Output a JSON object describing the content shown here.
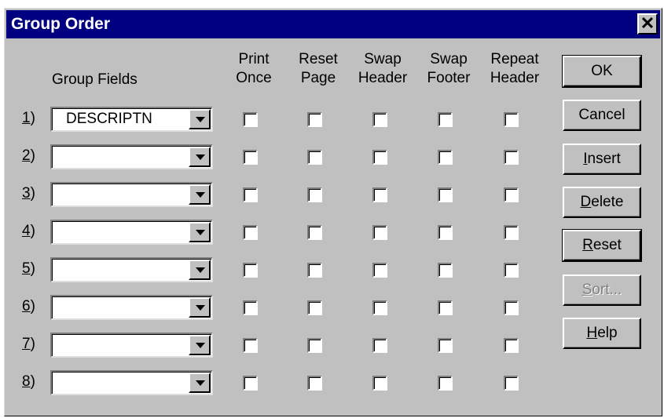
{
  "window": {
    "title": "Group Order",
    "close_glyph": "✕"
  },
  "group_fields_label": "Group Fields",
  "columns": [
    {
      "line1": "Print",
      "line2": "Once"
    },
    {
      "line1": "Reset",
      "line2": "Page"
    },
    {
      "line1": "Swap",
      "line2": "Header"
    },
    {
      "line1": "Swap",
      "line2": "Footer"
    },
    {
      "line1": "Repeat",
      "line2": "Header"
    }
  ],
  "rows": [
    {
      "num": "1",
      "suffix": ")",
      "value": "DESCRIPTN"
    },
    {
      "num": "2",
      "suffix": ")",
      "value": ""
    },
    {
      "num": "3",
      "suffix": ")",
      "value": ""
    },
    {
      "num": "4",
      "suffix": ")",
      "value": ""
    },
    {
      "num": "5",
      "suffix": ")",
      "value": ""
    },
    {
      "num": "6",
      "suffix": ")",
      "value": ""
    },
    {
      "num": "7",
      "suffix": ")",
      "value": ""
    },
    {
      "num": "8",
      "suffix": ")",
      "value": ""
    }
  ],
  "buttons": {
    "ok": {
      "label": "OK"
    },
    "cancel": {
      "label": "Cancel"
    },
    "insert": {
      "mnemonic": "I",
      "rest": "nsert"
    },
    "delete": {
      "mnemonic": "D",
      "rest": "elete"
    },
    "reset": {
      "mnemonic": "R",
      "rest": "eset"
    },
    "sort": {
      "mnemonic": "S",
      "rest": "ort..."
    },
    "help": {
      "mnemonic": "H",
      "rest": "elp"
    }
  }
}
